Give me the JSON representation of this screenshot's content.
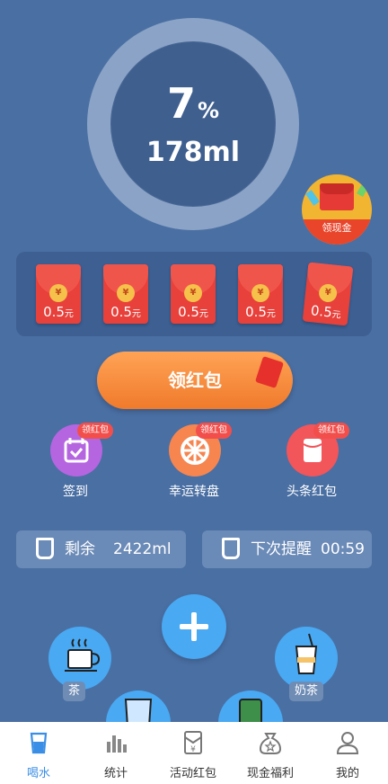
{
  "progress": {
    "percent_value": "7",
    "percent_symbol": "%",
    "volume": "178ml",
    "fraction": 0.07
  },
  "cash_badge": {
    "label": "领现金"
  },
  "red_packets": [
    {
      "amount": "0.5",
      "unit": "元",
      "coin": "¥"
    },
    {
      "amount": "0.5",
      "unit": "元",
      "coin": "¥"
    },
    {
      "amount": "0.5",
      "unit": "元",
      "coin": "¥"
    },
    {
      "amount": "0.5",
      "unit": "元",
      "coin": "¥"
    },
    {
      "amount": "0.5",
      "unit": "元",
      "coin": "¥"
    }
  ],
  "claim_button": {
    "label": "领红包"
  },
  "shortcuts": [
    {
      "label": "签到",
      "tag": "领红包",
      "color": "#b565e0",
      "icon": "calendar-icon"
    },
    {
      "label": "幸运转盘",
      "tag": "领红包",
      "color": "#f68550",
      "icon": "wheel-icon"
    },
    {
      "label": "头条红包",
      "tag": "领红包",
      "color": "#f2555a",
      "icon": "packet-icon"
    }
  ],
  "info": {
    "remaining_label": "剩余",
    "remaining_value": "2422ml",
    "reminder_label": "下次提醒",
    "reminder_value": "00:59"
  },
  "drinks": {
    "tea": "茶",
    "milk_tea": "奶茶"
  },
  "tabs": [
    {
      "label": "喝水",
      "icon": "water-cup-icon",
      "active": true
    },
    {
      "label": "统计",
      "icon": "bar-chart-icon"
    },
    {
      "label": "活动红包",
      "icon": "red-envelope-icon"
    },
    {
      "label": "现金福利",
      "icon": "money-bag-icon"
    },
    {
      "label": "我的",
      "icon": "user-icon"
    }
  ],
  "colors": {
    "background": "#4a6fa3",
    "accent": "#49a9f2",
    "orange": "#f07a2c",
    "red": "#e8403a"
  }
}
